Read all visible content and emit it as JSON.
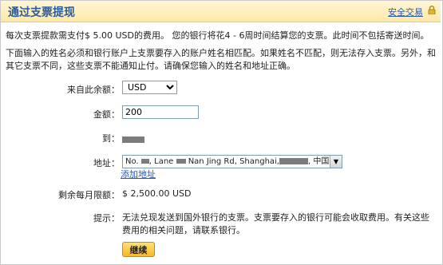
{
  "header": {
    "title": "通过支票提现",
    "secure_link": "安全交易",
    "lock_icon": "lock-icon",
    "background": "#fde9a5"
  },
  "info": {
    "fee_text": "每次支票提款需支付$ 5.00 USD的费用。 您的银行将花4 - 6周时间结算您的支票。此时间不包括寄送时间。",
    "name_notice": "下面输入的姓名必须和银行账户上支票要存入的账户姓名相匹配。如果姓名不匹配，则无法存入支票。另外，和其它支票不同，这些支票不能通知止付。请确保您输入的姓名和地址正确。"
  },
  "form": {
    "from_balance": {
      "label": "来自此余额：",
      "selected": "USD"
    },
    "amount": {
      "label": "金额：",
      "value": "200"
    },
    "to": {
      "label": "到："
    },
    "address": {
      "label": "地址：",
      "part_1": "No. ",
      "part_2": ", Lane ",
      "part_3": " Nan Jing Rd, Shanghai,",
      "part_4": ", 中国",
      "add_link": "添加地址",
      "dropdown_icon": "chevron-down-icon"
    },
    "monthly_limit": {
      "label": "剩余每月限额：",
      "value": "$ 2,500.00 USD"
    },
    "hint": {
      "label": "提示：",
      "text": "无法兑现发送到国外银行的支票。支票要存入的银行可能会收取费用。有关这些费用的相关问题，请联系银行。"
    },
    "continue_button": "继续"
  }
}
